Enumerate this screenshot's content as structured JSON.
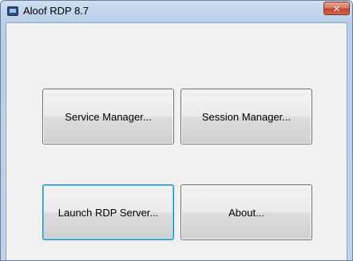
{
  "window": {
    "title": "Aloof RDP 8.7",
    "icon": "app-icon",
    "close_glyph": "✕"
  },
  "buttons": {
    "service_manager": "Service Manager...",
    "session_manager": "Session Manager...",
    "launch_rdp_server": "Launch RDP Server...",
    "about": "About..."
  },
  "focused_button": "launch_rdp_server"
}
